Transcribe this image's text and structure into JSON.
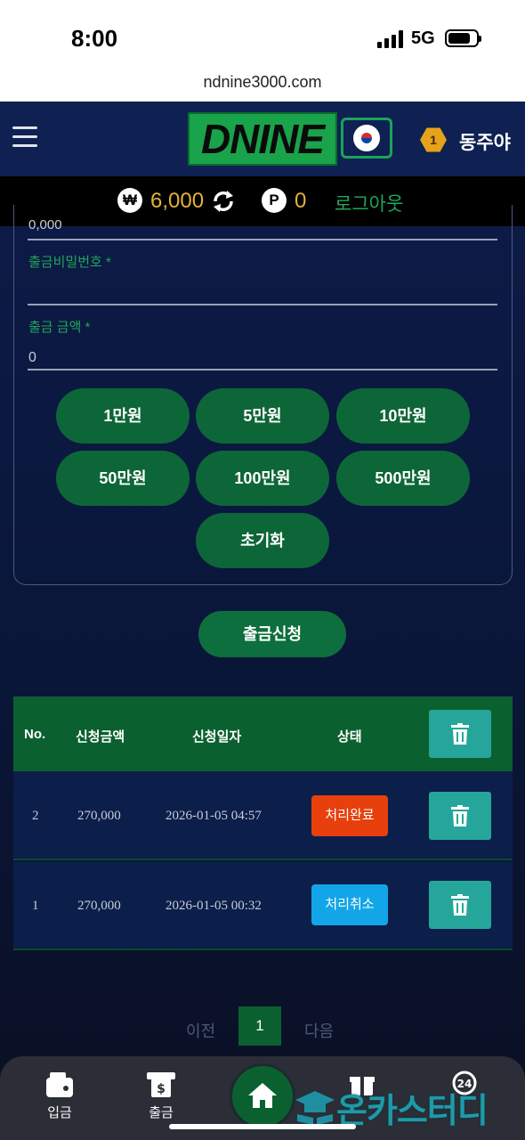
{
  "status": {
    "time": "8:00",
    "network": "5G"
  },
  "browser": {
    "url": "ndnine3000.com"
  },
  "header": {
    "logo_text": "DNINE",
    "level": "1",
    "username": "동주야"
  },
  "balance": {
    "currency_icon": "₩",
    "amount": "6,000",
    "point_icon": "P",
    "points": "0",
    "logout_label": "로그아웃"
  },
  "form": {
    "prev_value_cut": "0,000",
    "password_label": "출금비밀번호 *",
    "amount_label": "출금 금액 *",
    "amount_value": "0",
    "quick_amounts": [
      "1만원",
      "5만원",
      "10만원",
      "50만원",
      "100만원",
      "500만원"
    ],
    "reset_label": "초기화",
    "submit_label": "출금신청"
  },
  "table": {
    "headers": [
      "No.",
      "신청금액",
      "신청일자",
      "상태"
    ],
    "rows": [
      {
        "no": "2",
        "amount": "270,000",
        "date": "2026-01-05 04:57",
        "status": "처리완료",
        "status_color": "#e8400c"
      },
      {
        "no": "1",
        "amount": "270,000",
        "date": "2026-01-05 00:32",
        "status": "처리취소",
        "status_color": "#12a6e8"
      }
    ]
  },
  "pagination": {
    "prev": "이전",
    "current": "1",
    "next": "다음"
  },
  "bottom_nav": {
    "items": [
      {
        "label": "입금",
        "icon": "wallet-icon"
      },
      {
        "label": "출금",
        "icon": "withdraw-icon"
      },
      {
        "label": "",
        "icon": "home-icon"
      },
      {
        "label": "",
        "icon": "gift-icon"
      },
      {
        "label": "",
        "icon": "support-24-icon"
      }
    ]
  },
  "watermark": "온카스터디",
  "colors": {
    "accent_green": "#0b6030",
    "header_bg": "#0e2152",
    "balance_gold": "#e3b23c"
  }
}
